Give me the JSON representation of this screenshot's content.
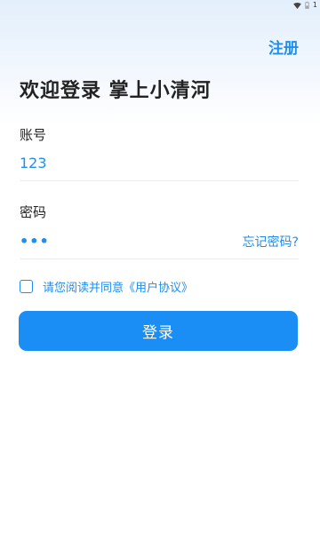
{
  "status_bar": {
    "wifi_icon": "wifi-icon",
    "battery_icon": "battery-icon",
    "time_text": "1"
  },
  "header": {
    "register_label": "注册",
    "title": "欢迎登录 掌上小清河"
  },
  "form": {
    "account_label": "账号",
    "account_value": "123",
    "password_label": "密码",
    "password_masked": "•••",
    "forgot_label": "忘记密码?",
    "agree_prefix": "请您阅读并同意",
    "agreement_link": "《用户协议》",
    "agree_checked": false,
    "login_label": "登录"
  },
  "colors": {
    "accent": "#1f8eef",
    "button": "#1b8ef5",
    "title_text": "#222222"
  }
}
